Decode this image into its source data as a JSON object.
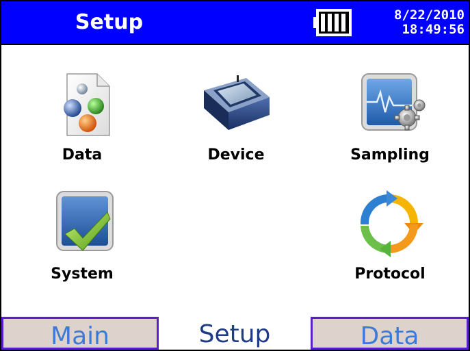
{
  "header": {
    "title": "Setup",
    "date": "8/22/2010",
    "time": "18:49:56",
    "battery_icon": "battery-full-icon",
    "background_color": "#0000ff"
  },
  "tiles": [
    {
      "label": "Data",
      "icon": "data-file-icon"
    },
    {
      "label": "Device",
      "icon": "device-icon"
    },
    {
      "label": "Sampling",
      "icon": "sampling-monitor-icon"
    },
    {
      "label": "System",
      "icon": "system-check-icon"
    },
    {
      "label": "Protocol",
      "icon": "protocol-cycle-icon"
    }
  ],
  "tabs": [
    {
      "label": "Main",
      "active": false
    },
    {
      "label": "Setup",
      "active": true
    },
    {
      "label": "Data",
      "active": false
    }
  ]
}
